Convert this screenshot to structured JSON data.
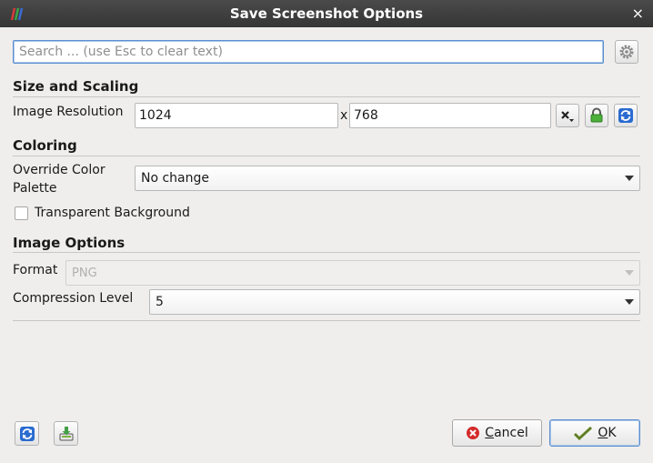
{
  "window": {
    "title": "Save Screenshot Options",
    "close_glyph": "×"
  },
  "search": {
    "placeholder": "Search ... (use Esc to clear text)",
    "value": ""
  },
  "size_scaling": {
    "header": "Size and Scaling",
    "resolution_label": "Image Resolution",
    "width": "1024",
    "separator": "x",
    "height": "768"
  },
  "coloring": {
    "header": "Coloring",
    "palette_label_line1": "Override Color",
    "palette_label_line2": "Palette",
    "palette_value": "No change",
    "transparent_label": "Transparent Background",
    "transparent_checked": false
  },
  "image_options": {
    "header": "Image Options",
    "format_label": "Format",
    "format_value": "PNG",
    "compression_label": "Compression Level",
    "compression_value": "5"
  },
  "footer": {
    "cancel_label_first": "C",
    "cancel_label_rest": "ancel",
    "ok_label_first": "O",
    "ok_label_rest": "K"
  },
  "icons": {
    "app_logo": "paraview-logo-icon",
    "settings": "gear-icon",
    "clear": "clear-dropdown-icon",
    "lock": "lock-icon",
    "swap": "refresh-icon",
    "reset": "refresh-icon",
    "save_defaults": "save-defaults-icon",
    "cancel": "cancel-icon",
    "ok": "ok-check-icon"
  },
  "colors": {
    "accent": "#5b8fcf",
    "titlebar": "#3d3d3d",
    "cancel_red": "#d42a2a",
    "lock_green": "#4caf3a",
    "swap_blue": "#2a6bd0"
  }
}
